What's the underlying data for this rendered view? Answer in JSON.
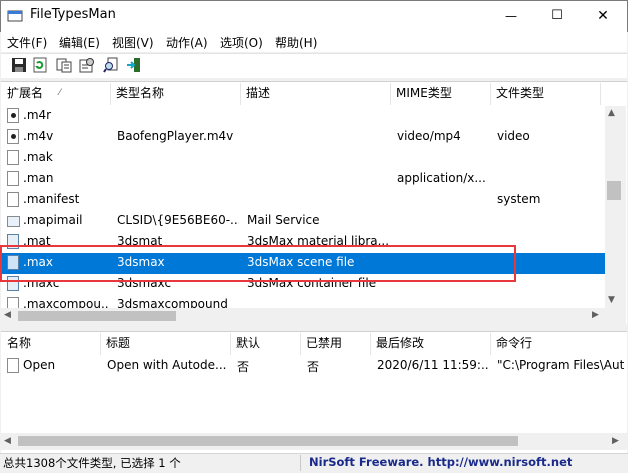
{
  "window": {
    "title": "FileTypesMan",
    "minimize_glyph": "—",
    "maximize_glyph": "☐",
    "close_glyph": "✕"
  },
  "menu": [
    "文件(F)",
    "编辑(E)",
    "视图(V)",
    "动作(A)",
    "选项(O)",
    "帮助(H)"
  ],
  "toolbar": {
    "icons": [
      "save-icon",
      "refresh-icon",
      "copy-icon",
      "properties-icon",
      "find-icon",
      "exit-icon"
    ]
  },
  "file_list": {
    "columns": [
      "扩展名",
      "类型名称",
      "描述",
      "MIME类型",
      "文件类型"
    ],
    "sort_indicator": "⁄",
    "rows": [
      {
        "ext": ".m4r",
        "type": "",
        "desc": "",
        "mime": "",
        "ftype": "",
        "icon": "media"
      },
      {
        "ext": ".m4v",
        "type": "BaofengPlayer.m4v",
        "desc": "",
        "mime": "video/mp4",
        "ftype": "video",
        "icon": "media"
      },
      {
        "ext": ".mak",
        "type": "",
        "desc": "",
        "mime": "",
        "ftype": "",
        "icon": "blank"
      },
      {
        "ext": ".man",
        "type": "",
        "desc": "",
        "mime": "application/x...",
        "ftype": "",
        "icon": "blank"
      },
      {
        "ext": ".manifest",
        "type": "",
        "desc": "",
        "mime": "",
        "ftype": "system",
        "icon": "blank"
      },
      {
        "ext": ".mapimail",
        "type": "CLSID\\{9E56BE60-...",
        "desc": "Mail Service",
        "mime": "",
        "ftype": "",
        "icon": "mail"
      },
      {
        "ext": ".mat",
        "type": "3dsmat",
        "desc": "3dsMax material libra...",
        "mime": "",
        "ftype": "",
        "icon": "max"
      },
      {
        "ext": ".max",
        "type": "3dsmax",
        "desc": "3dsMax scene file",
        "mime": "",
        "ftype": "",
        "icon": "max",
        "selected": true
      },
      {
        "ext": ".maxc",
        "type": "3dsmaxc",
        "desc": "3dsMax container file",
        "mime": "",
        "ftype": "",
        "icon": "max"
      },
      {
        "ext": ".maxcompou...",
        "type": "3dsmaxcompound",
        "desc": "",
        "mime": "",
        "ftype": "",
        "icon": "blank"
      }
    ]
  },
  "action_list": {
    "columns": [
      "名称",
      "标题",
      "默认",
      "已禁用",
      "最后修改",
      "命令行"
    ],
    "rows": [
      {
        "name": "Open",
        "title": "Open with Autode...",
        "default": "否",
        "disabled": "否",
        "modified": "2020/6/11 11:59:...",
        "cmd": "\"C:\\Program Files\\Aut"
      }
    ]
  },
  "status": {
    "left": "总共1308个文件类型, 已选择 1 个",
    "right": "NirSoft Freeware.  http://www.nirsoft.net"
  },
  "colors": {
    "selection": "#0078d7",
    "highlight_box": "#e8383d"
  }
}
